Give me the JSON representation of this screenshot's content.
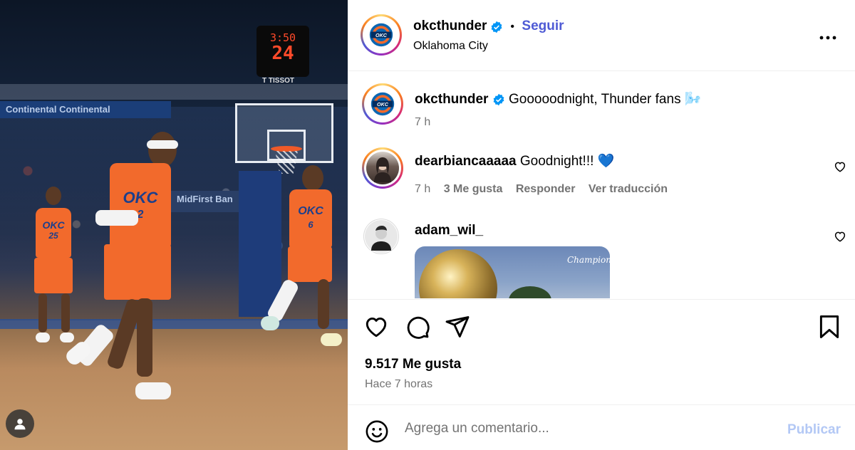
{
  "post": {
    "author": "okcthunder",
    "follow_label": "Seguir",
    "separator": "•",
    "location": "Oklahoma City",
    "more_icon": "more-horizontal-icon",
    "caption": "Gooooodnight, Thunder fans 🌬️",
    "caption_time": "7 h",
    "photo": {
      "shot_clock_time": "3:50",
      "shot_clock_value": "24",
      "sponsor": "T TISSOT",
      "banner_1": "Continental  Continental",
      "banner_2": "MidFirst Ban",
      "jersey_numbers": [
        "25",
        "2",
        "6"
      ],
      "jersey_text": "OKC"
    }
  },
  "comments": [
    {
      "username": "dearbiancaaaaa",
      "text": "Goodnight!!! 💙",
      "time": "7 h",
      "likes": "3 Me gusta",
      "reply_label": "Responder",
      "translate_label": "Ver traducción"
    },
    {
      "username": "adam_wil_",
      "image_caption": "Champions"
    }
  ],
  "actions": {
    "like_count": "9.517 Me gusta",
    "posted_ago": "Hace 7 horas"
  },
  "comment_box": {
    "placeholder": "Agrega un comentario...",
    "publish_label": "Publicar"
  },
  "colors": {
    "thunder_orange": "#f26a2c",
    "thunder_blue": "#1c3f8c",
    "link_blue": "#4f5bd5",
    "verified_blue": "#0095f6",
    "publish_disabled": "#b3c8f5",
    "muted_text": "#737373"
  }
}
